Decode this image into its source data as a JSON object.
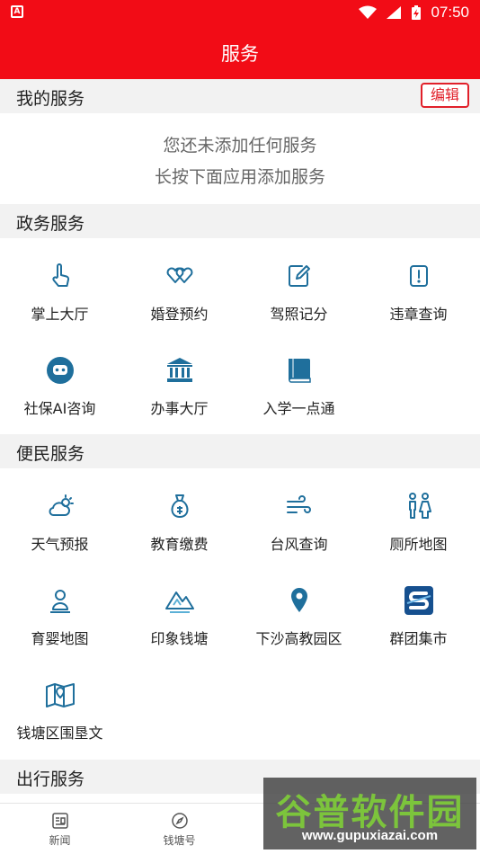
{
  "statusbar": {
    "time": "07:50",
    "left_icon": "A"
  },
  "header": {
    "title": "服务"
  },
  "my_services": {
    "title": "我的服务",
    "edit_label": "编辑",
    "empty_line1": "您还未添加任何服务",
    "empty_line2": "长按下面应用添加服务"
  },
  "gov_services": {
    "title": "政务服务",
    "items": [
      {
        "label": "掌上大厅",
        "icon": "hand-pointer-icon"
      },
      {
        "label": "婚登预约",
        "icon": "double-heart-icon"
      },
      {
        "label": "驾照记分",
        "icon": "edit-note-icon"
      },
      {
        "label": "违章查询",
        "icon": "alert-card-icon"
      },
      {
        "label": "社保AI咨询",
        "icon": "robot-icon"
      },
      {
        "label": "办事大厅",
        "icon": "bank-icon"
      },
      {
        "label": "入学一点通",
        "icon": "book-icon"
      }
    ]
  },
  "civic_services": {
    "title": "便民服务",
    "items": [
      {
        "label": "天气预报",
        "icon": "weather-icon"
      },
      {
        "label": "教育缴费",
        "icon": "money-bag-icon"
      },
      {
        "label": "台风查询",
        "icon": "wind-icon"
      },
      {
        "label": "厕所地图",
        "icon": "restroom-icon"
      },
      {
        "label": "育婴地图",
        "icon": "baby-location-icon"
      },
      {
        "label": "印象钱塘",
        "icon": "mountain-icon"
      },
      {
        "label": "下沙高教园区",
        "icon": "map-pin-icon"
      },
      {
        "label": "群团集市",
        "icon": "s-logo-icon"
      },
      {
        "label": "钱塘区围垦文",
        "icon": "folded-map-icon"
      }
    ]
  },
  "travel_services": {
    "title": "出行服务"
  },
  "bottom_nav": {
    "items": [
      {
        "label": "新闻",
        "icon": "news-icon"
      },
      {
        "label": "钱塘号",
        "icon": "compass-icon"
      }
    ]
  },
  "watermark": {
    "title": "谷普软件园",
    "url": "www.gupuxiazai.com"
  },
  "colors": {
    "brand_red": "#f20c16",
    "icon_blue": "#1f6f9c",
    "header_gray": "#f2f2f2"
  }
}
